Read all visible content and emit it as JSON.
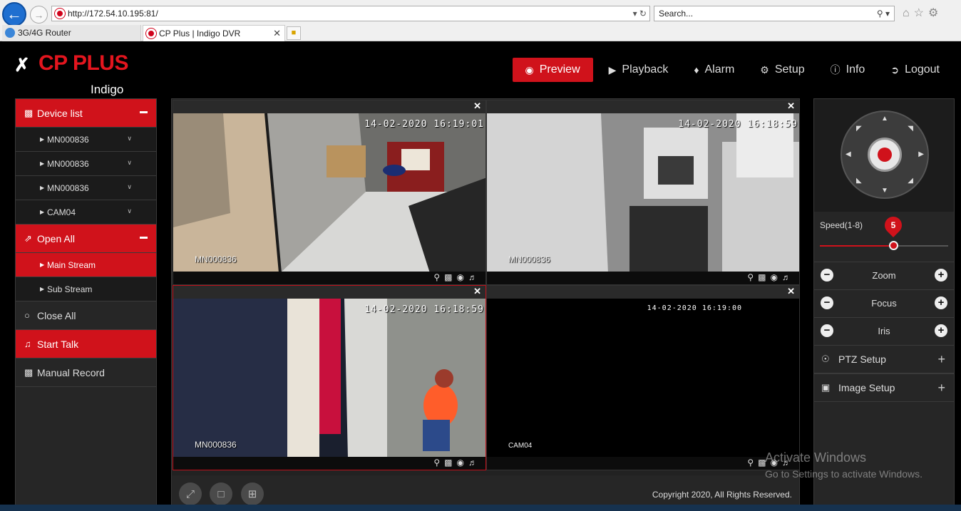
{
  "browser": {
    "url": "http://172.54.10.195:81/",
    "search_placeholder": "Search...",
    "tabs": [
      {
        "label": "3G/4G Router"
      },
      {
        "label": "CP Plus | Indigo DVR"
      }
    ]
  },
  "app": {
    "brand": "CP PLUS",
    "brand_sub": "Indigo",
    "nav": [
      {
        "label": "Preview",
        "icon": "eye-icon",
        "active": true
      },
      {
        "label": "Playback",
        "icon": "play-icon"
      },
      {
        "label": "Alarm",
        "icon": "bell-icon"
      },
      {
        "label": "Setup",
        "icon": "gear-icon"
      },
      {
        "label": "Info",
        "icon": "info-icon"
      },
      {
        "label": "Logout",
        "icon": "logout-icon"
      }
    ],
    "accent": "#d0121b"
  },
  "sidebar": {
    "device_list_label": "Device list",
    "devices": [
      {
        "label": "MN000836"
      },
      {
        "label": "MN000836"
      },
      {
        "label": "MN000836"
      },
      {
        "label": "CAM04"
      }
    ],
    "open_all_label": "Open All",
    "streams": [
      {
        "label": "Main Stream",
        "selected": true
      },
      {
        "label": "Sub Stream"
      }
    ],
    "close_all_label": "Close All",
    "start_talk_label": "Start Talk",
    "manual_record_label": "Manual Record"
  },
  "cameras": [
    {
      "timestamp": "14-02-2020 16:19:01",
      "label": "MN000836"
    },
    {
      "timestamp": "14-02-2020 16:18:59",
      "label": "MN000836"
    },
    {
      "timestamp": "14-02-2020 16:18:59",
      "label": "MN000836"
    },
    {
      "timestamp": "14-02-2020 16:19:00",
      "label": "CAM04"
    }
  ],
  "footer": {
    "copyright": "Copyright 2020, All Rights Reserved."
  },
  "ptz": {
    "speed_label": "Speed(1-8)",
    "speed_value": "5",
    "speed_fraction": 0.57,
    "zoom_label": "Zoom",
    "focus_label": "Focus",
    "iris_label": "Iris",
    "ptz_setup_label": "PTZ Setup",
    "image_setup_label": "Image Setup"
  },
  "watermark": {
    "line1": "Activate Windows",
    "line2": "Go to Settings to activate Windows."
  }
}
